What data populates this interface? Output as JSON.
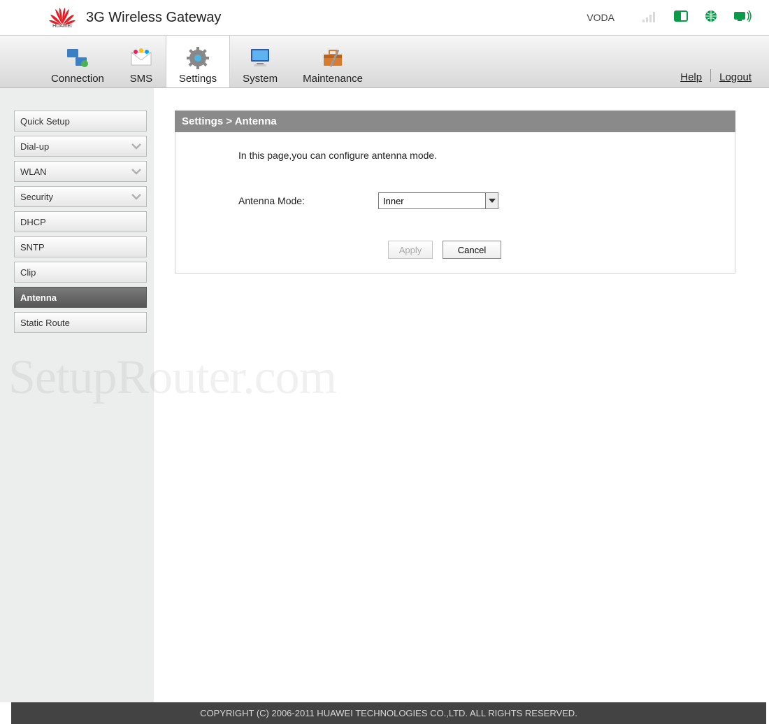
{
  "header": {
    "brand": "HUAWEI",
    "title": "3G Wireless Gateway",
    "carrier": "VODA"
  },
  "nav": {
    "items": [
      {
        "label": "Connection",
        "icon": "connection"
      },
      {
        "label": "SMS",
        "icon": "sms"
      },
      {
        "label": "Settings",
        "icon": "settings",
        "active": true
      },
      {
        "label": "System",
        "icon": "system"
      },
      {
        "label": "Maintenance",
        "icon": "maintenance"
      }
    ],
    "help": "Help",
    "logout": "Logout"
  },
  "sidebar": {
    "items": [
      {
        "label": "Quick Setup",
        "expandable": false
      },
      {
        "label": "Dial-up",
        "expandable": true
      },
      {
        "label": "WLAN",
        "expandable": true
      },
      {
        "label": "Security",
        "expandable": true
      },
      {
        "label": "DHCP",
        "expandable": false
      },
      {
        "label": "SNTP",
        "expandable": false
      },
      {
        "label": "Clip",
        "expandable": false
      },
      {
        "label": "Antenna",
        "expandable": false,
        "active": true
      },
      {
        "label": "Static Route",
        "expandable": false
      }
    ]
  },
  "main": {
    "breadcrumb": "Settings > Antenna",
    "description": "In this page,you can configure antenna mode.",
    "form": {
      "label": "Antenna Mode:",
      "value": "Inner"
    },
    "buttons": {
      "apply": "Apply",
      "cancel": "Cancel"
    }
  },
  "watermark": "SetupRouter.com",
  "footer": "COPYRIGHT (C) 2006-2011 HUAWEI TECHNOLOGIES CO.,LTD. ALL RIGHTS RESERVED."
}
